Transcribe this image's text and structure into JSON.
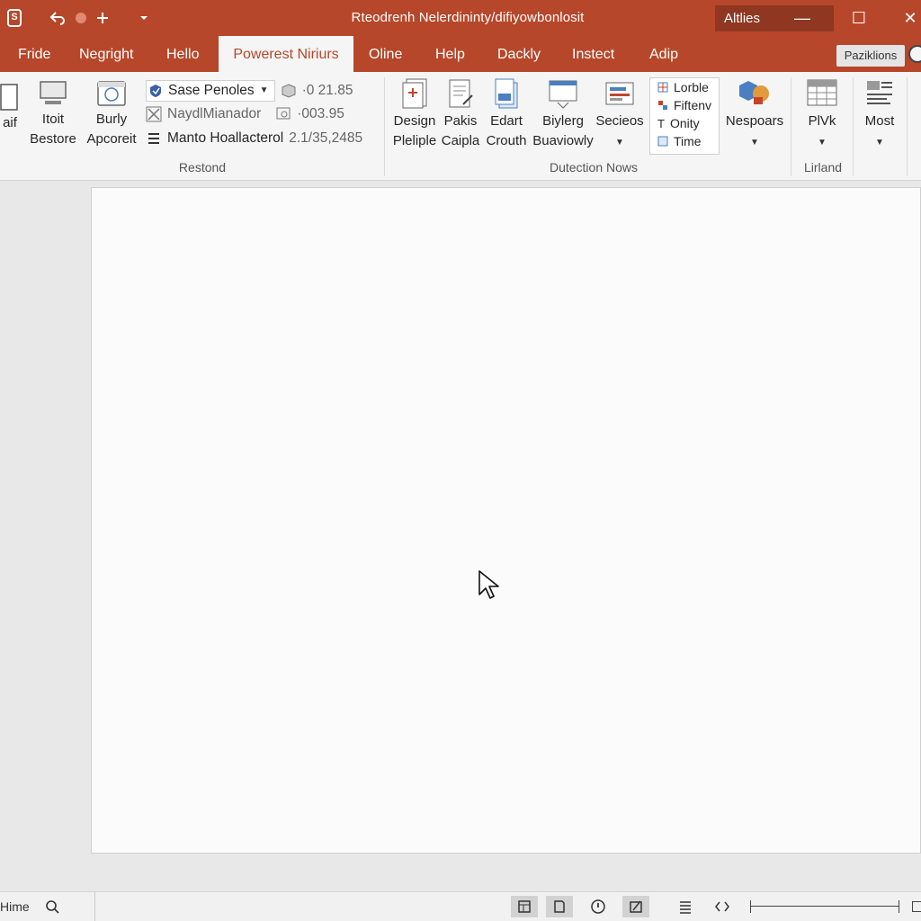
{
  "titlebar": {
    "document_title": "Rteodrenh Nelerdininty/difiyowbonlosit",
    "account_label": "Altlies",
    "qa_undo_icon": "undo-icon",
    "qa_redo_icon": "redo-icon",
    "qa_new_icon": "plus-icon",
    "qa_more_icon": "chevron-down-icon",
    "minimize_glyph": "—",
    "maximize_glyph": "☐",
    "close_glyph": "✕"
  },
  "tabs": [
    {
      "label": "Fride"
    },
    {
      "label": "Negright"
    },
    {
      "label": "Hello"
    },
    {
      "label": "Powerest Niriurs",
      "active": true
    },
    {
      "label": "Oline"
    },
    {
      "label": "Help"
    },
    {
      "label": "Dackly"
    },
    {
      "label": "Instect"
    },
    {
      "label": "Adip"
    }
  ],
  "share_label": "Paziklions",
  "ribbon": {
    "group1": {
      "partial_label": "aif",
      "btn1_line1": "Itoit",
      "btn1_line2": "Bestore",
      "btn2_line1": "Burly",
      "btn2_line2": "Apcoreit",
      "row1_label": "Sase Penoles",
      "row1_value": "·0 21.85",
      "row2_label": "NaydlMianador",
      "row2_value": "·003.95",
      "row3_label": "Manto Hoallacterol",
      "row3_value": "2.1/35,2485",
      "group_label": "Restond"
    },
    "group2": {
      "btn1_line1": "Design",
      "btn1_line2": "Pleliple",
      "btn2_line1": "Pakis",
      "btn2_line2": "Caipla",
      "btn3_line1": "Edart",
      "btn3_line2": "Crouth",
      "btn4_line1": "Biylerg",
      "btn4_line2": "Buaviowly",
      "btn5_label": "Secieos",
      "gallery": [
        "Lorble",
        "Fiftenv",
        "Onity",
        "Time"
      ],
      "btn6_label": "Nespoars",
      "group_label": "Dutection Nows"
    },
    "group3": {
      "btn_label": "PlVk",
      "group_label": "Lirland"
    },
    "group4": {
      "btn_label": "Most"
    }
  },
  "statusbar": {
    "left_label": "Hime",
    "view_icons": [
      "normal-view-icon",
      "outline-view-icon",
      "info-icon",
      "edit-view-icon",
      "list-icon",
      "code-icon"
    ]
  },
  "colors": {
    "accent": "#b7472a",
    "accent_dark": "#8f3720",
    "ribbon_bg": "#f5f5f5",
    "canvas_bg": "#e8e8e8"
  }
}
